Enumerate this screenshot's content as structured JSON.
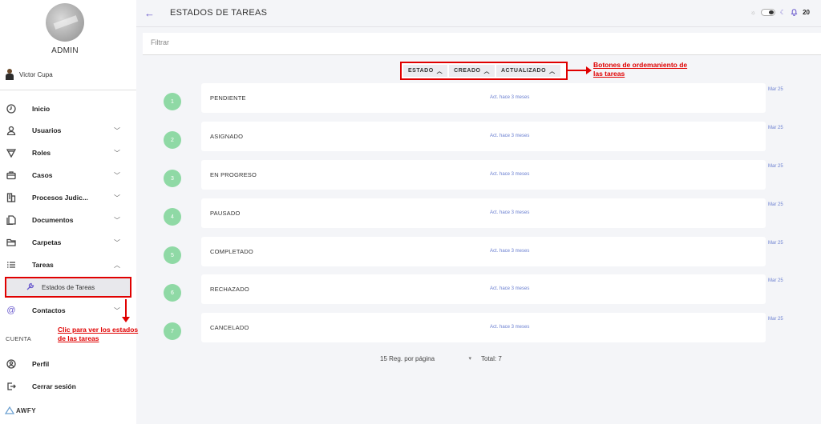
{
  "sidebar": {
    "admin_label": "ADMIN",
    "user_name": "Victor Cupa",
    "items": [
      {
        "label": "Inicio",
        "icon": "clock-icon"
      },
      {
        "label": "Usuarios",
        "icon": "user-icon"
      },
      {
        "label": "Roles",
        "icon": "roles-icon"
      },
      {
        "label": "Casos",
        "icon": "briefcase-icon"
      },
      {
        "label": "Procesos Judic...",
        "icon": "building-icon"
      },
      {
        "label": "Documentos",
        "icon": "documents-icon"
      },
      {
        "label": "Carpetas",
        "icon": "folder-icon"
      },
      {
        "label": "Tareas",
        "icon": "list-icon"
      },
      {
        "label": "Contactos",
        "icon": "at-icon"
      }
    ],
    "sub_item": "Estados de Tareas",
    "section_account": "CUENTA",
    "account_items": [
      {
        "label": "Perfil",
        "icon": "profile-icon"
      },
      {
        "label": "Cerrar sesión",
        "icon": "logout-icon"
      }
    ],
    "brand": "AWFY"
  },
  "header": {
    "title": "ESTADOS DE TAREAS",
    "notifications": "20"
  },
  "filter": {
    "placeholder": "Filtrar"
  },
  "sort_buttons": [
    "ESTADO",
    "CREADO",
    "ACTUALIZADO"
  ],
  "annotations": {
    "sort_note_line1": "Botones de ordemaniento de",
    "sort_note_line2": "las tareas",
    "side_note_line1": "Clic para ver los estados",
    "side_note_line2": "de las tareas"
  },
  "rows": [
    {
      "num": "1",
      "name": "PENDIENTE",
      "updated": "Act. hace 3 meses",
      "date": "Mar 25"
    },
    {
      "num": "2",
      "name": "ASIGNADO",
      "updated": "Act. hace 3 meses",
      "date": "Mar 25"
    },
    {
      "num": "3",
      "name": "EN PROGRESO",
      "updated": "Act. hace 3 meses",
      "date": "Mar 25"
    },
    {
      "num": "4",
      "name": "PAUSADO",
      "updated": "Act. hace 3 meses",
      "date": "Mar 25"
    },
    {
      "num": "5",
      "name": "COMPLETADO",
      "updated": "Act. hace 3 meses",
      "date": "Mar 25"
    },
    {
      "num": "6",
      "name": "RECHAZADO",
      "updated": "Act. hace 3 meses",
      "date": "Mar 25"
    },
    {
      "num": "7",
      "name": "CANCELADO",
      "updated": "Act. hace 3 meses",
      "date": "Mar 25"
    }
  ],
  "pagination": {
    "per_page": "15 Reg. por página",
    "total": "Total: 7"
  },
  "colors": {
    "accent": "#6a5acd",
    "badge": "#8fd9a5",
    "annotation": "#e00000"
  }
}
